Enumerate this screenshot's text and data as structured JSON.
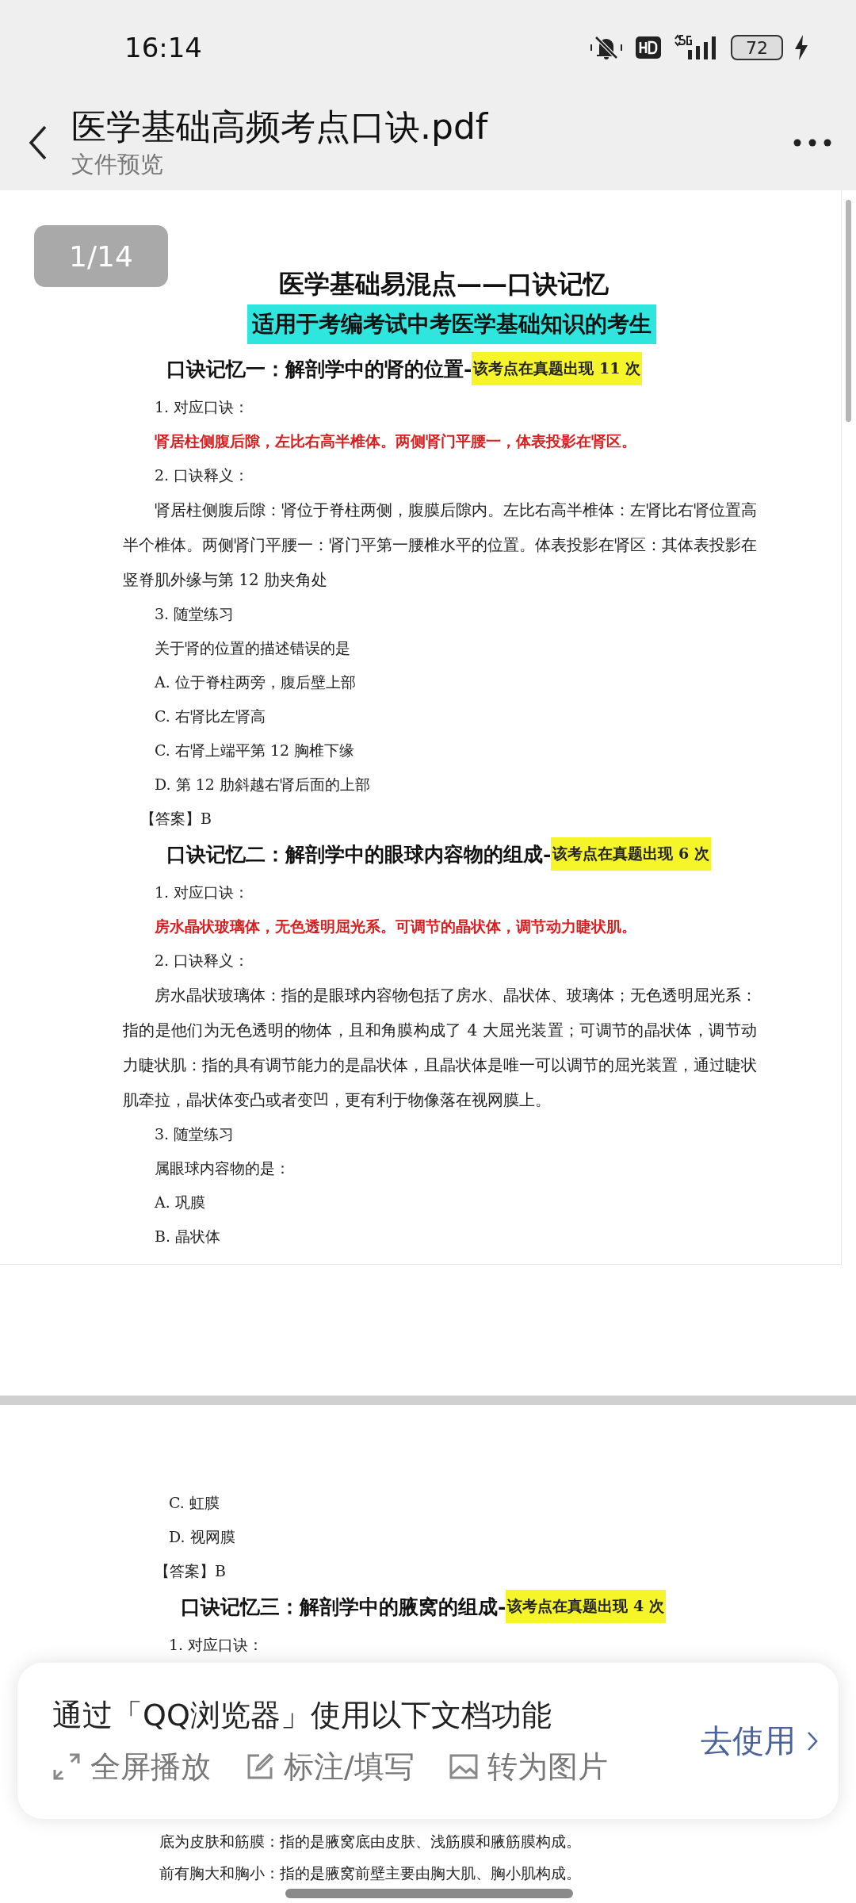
{
  "status_bar": {
    "time": "16:14",
    "battery": "72"
  },
  "header": {
    "title": "医学基础高频考点口诀.pdf",
    "subtitle": "文件预览"
  },
  "page_indicator": "1/14",
  "pages": [
    {
      "blocks": [
        {
          "kind": "title",
          "text": "医学基础易混点——口诀记忆"
        },
        {
          "kind": "banner",
          "text": "适用于考编考试中考医学基础知识的考生"
        },
        {
          "kind": "heading",
          "text": "口诀记忆一：解剖学中的肾的位置-",
          "tag": "该考点在真题出现 11 次"
        },
        {
          "kind": "line",
          "text": "1. 对应口诀："
        },
        {
          "kind": "mnemonic",
          "text": "肾居柱侧腹后隙，左比右高半椎体。两侧肾门平腰一，体表投影在肾区。"
        },
        {
          "kind": "line",
          "text": "2. 口诀释义："
        },
        {
          "kind": "paragraph",
          "text": "肾居柱侧腹后隙：肾位于脊柱两侧，腹膜后隙内。左比右高半椎体：左肾比右肾位置高半个椎体。两侧肾门平腰一：肾门平第一腰椎水平的位置。体表投影在肾区：其体表投影在竖脊肌外缘与第 12 肋夹角处"
        },
        {
          "kind": "line",
          "text": "3. 随堂练习"
        },
        {
          "kind": "line",
          "text": "关于肾的位置的描述错误的是"
        },
        {
          "kind": "line",
          "text": "A. 位于脊柱两旁，腹后壁上部"
        },
        {
          "kind": "line",
          "text": "C. 右肾比左肾高"
        },
        {
          "kind": "line",
          "text": "C. 右肾上端平第 12 胸椎下缘"
        },
        {
          "kind": "line",
          "text": "D. 第 12 肋斜越右肾后面的上部"
        },
        {
          "kind": "answer",
          "text": "【答案】B"
        },
        {
          "kind": "heading",
          "text": "口诀记忆二：解剖学中的眼球内容物的组成-",
          "tag": "该考点在真题出现 6 次"
        },
        {
          "kind": "line",
          "text": "1. 对应口诀："
        },
        {
          "kind": "mnemonic",
          "text": "房水晶状玻璃体，无色透明屈光系。可调节的晶状体，调节动力睫状肌。"
        },
        {
          "kind": "line",
          "text": "2. 口诀释义："
        },
        {
          "kind": "paragraph",
          "text": "房水晶状玻璃体：指的是眼球内容物包括了房水、晶状体、玻璃体；无色透明屈光系：指的是他们为无色透明的物体，且和角膜构成了 4 大屈光装置；可调节的晶状体，调节动力睫状肌：指的具有调节能力的是晶状体，且晶状体是唯一可以调节的屈光装置，通过睫状肌牵拉，晶状体变凸或者变凹，更有利于物像落在视网膜上。"
        },
        {
          "kind": "line",
          "text": "3. 随堂练习"
        },
        {
          "kind": "line",
          "text": "属眼球内容物的是："
        },
        {
          "kind": "line",
          "text": "A. 巩膜"
        },
        {
          "kind": "line",
          "text": "B. 晶状体"
        }
      ]
    },
    {
      "blocks": [
        {
          "kind": "line",
          "text": "C. 虹膜"
        },
        {
          "kind": "line",
          "text": "D. 视网膜"
        },
        {
          "kind": "answer",
          "text": "【答案】B"
        },
        {
          "kind": "heading",
          "text": "口诀记忆三：解剖学中的腋窝的组成-",
          "tag": "该考点在真题出现 4 次"
        },
        {
          "kind": "line",
          "text": "1. 对应口诀："
        }
      ],
      "tail_lines": [
        "底为皮肤和筋膜：指的是腋窝底由皮肤、浅筋膜和腋筋膜构成。",
        "前有胸大和胸小：指的是腋窝前壁主要由胸大肌、胸小肌构成。"
      ]
    }
  ],
  "promo": {
    "title": "通过「QQ浏览器」使用以下文档功能",
    "actions": [
      {
        "kind": "fullscreen",
        "label": "全屏播放"
      },
      {
        "kind": "annotate",
        "label": "标注/填写"
      },
      {
        "kind": "image",
        "label": "转为图片"
      }
    ],
    "button": "去使用"
  }
}
